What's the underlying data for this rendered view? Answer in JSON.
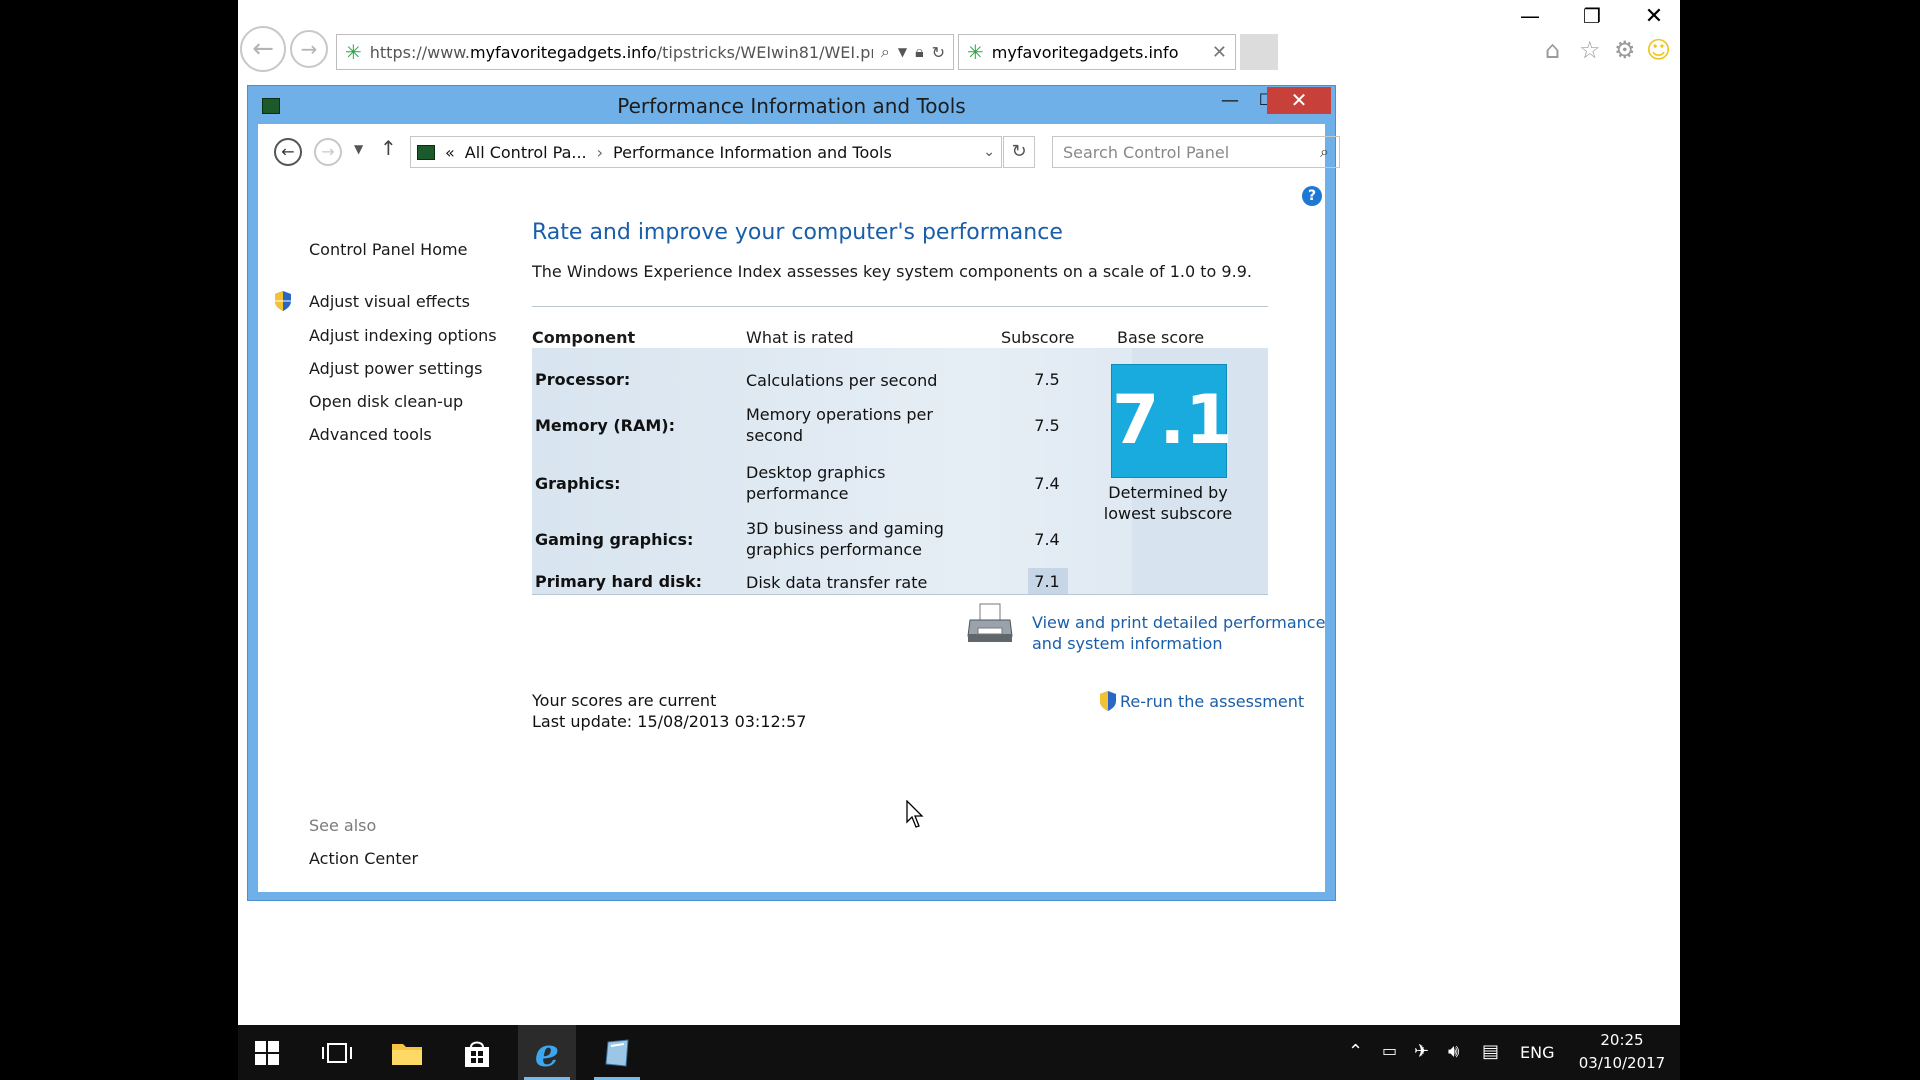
{
  "browser": {
    "address": {
      "scheme": "https://www.",
      "domain": "myfavoritegadgets.info",
      "path": "/tipstricks/WEIwin81/WEI.pr"
    },
    "tab_title": "myfavoritegadgets.info",
    "tab_close": "✕",
    "window_controls": {
      "minimize": "—",
      "restore": "❐",
      "close": "✕"
    }
  },
  "control_panel": {
    "title": "Performance Information and Tools",
    "breadcrumb": {
      "prefix": "«",
      "parent": "All Control Pa...",
      "current": "Performance Information and Tools"
    },
    "search_placeholder": "Search Control Panel",
    "help": "?",
    "sidebar": {
      "home": "Control Panel Home",
      "items": [
        "Adjust visual effects",
        "Adjust indexing options",
        "Adjust power settings",
        "Open disk clean-up",
        "Advanced tools"
      ],
      "see_also_label": "See also",
      "see_also_items": [
        "Action Center"
      ]
    },
    "main": {
      "title": "Rate and improve your computer's performance",
      "description": "The Windows Experience Index assesses key system components on a scale of 1.0 to 9.9.",
      "table": {
        "headers": {
          "component": "Component",
          "what": "What is rated",
          "subscore": "Subscore",
          "base": "Base score"
        },
        "rows": [
          {
            "component": "Processor:",
            "what": "Calculations per second",
            "subscore": "7.5"
          },
          {
            "component": "Memory (RAM):",
            "what": "Memory operations per second",
            "subscore": "7.5"
          },
          {
            "component": "Graphics:",
            "what": "Desktop graphics performance",
            "subscore": "7.4"
          },
          {
            "component": "Gaming graphics:",
            "what": "3D business and gaming graphics performance",
            "subscore": "7.4"
          },
          {
            "component": "Primary hard disk:",
            "what": "Disk data transfer rate",
            "subscore": "7.1"
          }
        ],
        "base_score": "7.1",
        "base_caption": "Determined by lowest subscore"
      },
      "view_link": "View and print detailed performance and system information",
      "status_line1": "Your scores are current",
      "status_line2": "Last update: 15/08/2013 03:12:57",
      "rerun": "Re-run the assessment"
    }
  },
  "taskbar": {
    "language": "ENG",
    "time": "20:25",
    "date": "03/10/2017"
  },
  "colors": {
    "accent": "#1a5ea9",
    "score_tile": "#1aabde",
    "window_frame": "#6fb0e8",
    "close_red": "#c7403a"
  }
}
